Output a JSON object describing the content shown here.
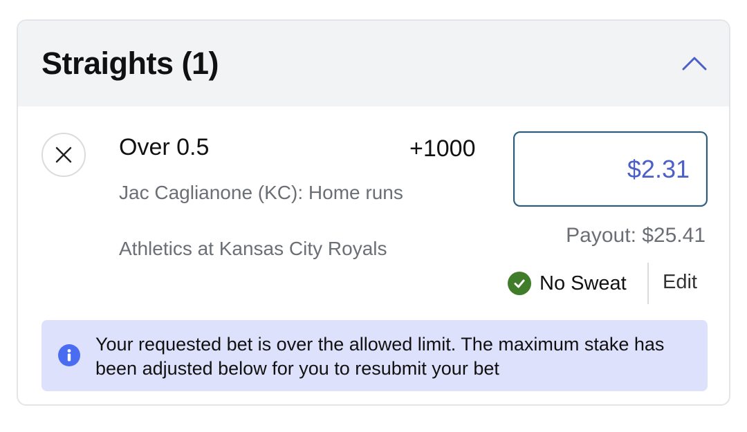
{
  "header": {
    "title": "Straights (1)",
    "collapse_icon": "chevron-up-icon",
    "accent_color": "#4a5fc7"
  },
  "bet": {
    "remove_icon": "close-icon",
    "title": "Over 0.5",
    "odds": "+1000",
    "market": "Jac Caglianone (KC): Home runs",
    "event": "Athletics at Kansas City Royals",
    "stake_value": "$2.31",
    "payout": "Payout: $25.41",
    "promo": {
      "icon": "check-circle-icon",
      "label": "No Sweat",
      "color": "#3f7d2a"
    },
    "edit_label": "Edit"
  },
  "alert": {
    "icon": "info-icon",
    "message": "Your requested bet is over the allowed limit. The maximum stake has been adjusted below for you to resubmit your bet",
    "background": "#dde1fb"
  }
}
